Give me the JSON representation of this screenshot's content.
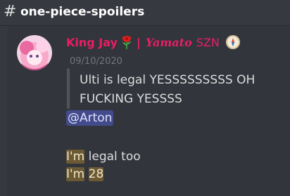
{
  "channel": {
    "hash": "#",
    "name": "one-piece-spoilers"
  },
  "message": {
    "username": "King Jay",
    "separator": "|",
    "tag": "Yamato",
    "suffix": "SZN",
    "timestamp": "09/10/2020",
    "quote": {
      "line1": "Ulti is legal YESSSSSSSSS OH",
      "line2": "FUCKING YESSSS"
    },
    "mention": "@Arton",
    "line1": {
      "hl": "I'm",
      "rest": " legal too"
    },
    "line2": {
      "hl1": "I'm",
      "sep": " ",
      "hl2": "28"
    },
    "icons": [
      "rose-emoji",
      "compass-emoji"
    ],
    "colors": {
      "username": "#e91e63",
      "mention_bg": "#5865f2",
      "highlight_bg": "#6b5a33"
    }
  }
}
